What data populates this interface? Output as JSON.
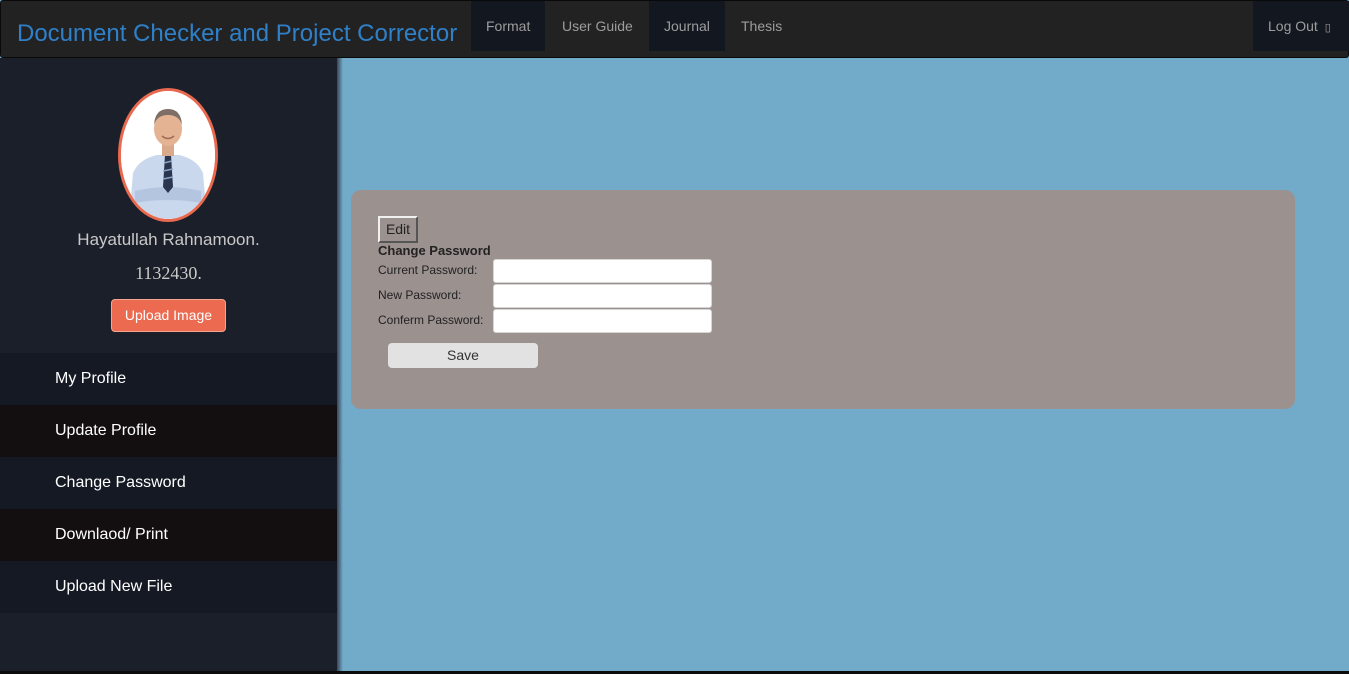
{
  "header": {
    "brand": "Document Checker and Project Corrector",
    "nav": [
      {
        "label": "Format"
      },
      {
        "label": "User Guide"
      },
      {
        "label": "Journal"
      },
      {
        "label": "Thesis"
      }
    ],
    "logout_label": "Log Out",
    "logout_icon": "log-out-icon"
  },
  "profile": {
    "name": "Hayatullah Rahnamoon.",
    "id": "1132430.",
    "upload_label": "Upload Image"
  },
  "sidebar": {
    "items": [
      {
        "label": "My Profile"
      },
      {
        "label": "Update Profile"
      },
      {
        "label": "Change Password"
      },
      {
        "label": "Downlaod/ Print"
      },
      {
        "label": "Upload New File"
      }
    ]
  },
  "form": {
    "edit_label": "Edit",
    "title": "Change Password",
    "fields": [
      {
        "label": "Current Password:",
        "value": ""
      },
      {
        "label": "New Password:",
        "value": ""
      },
      {
        "label": "Conferm Password:",
        "value": ""
      }
    ],
    "save_label": "Save"
  },
  "colors": {
    "brand": "#2f80c8",
    "accent": "#ec6a4f",
    "background": "#72aac9",
    "panel": "#9b918f",
    "sidebar": "#1b1f29"
  }
}
